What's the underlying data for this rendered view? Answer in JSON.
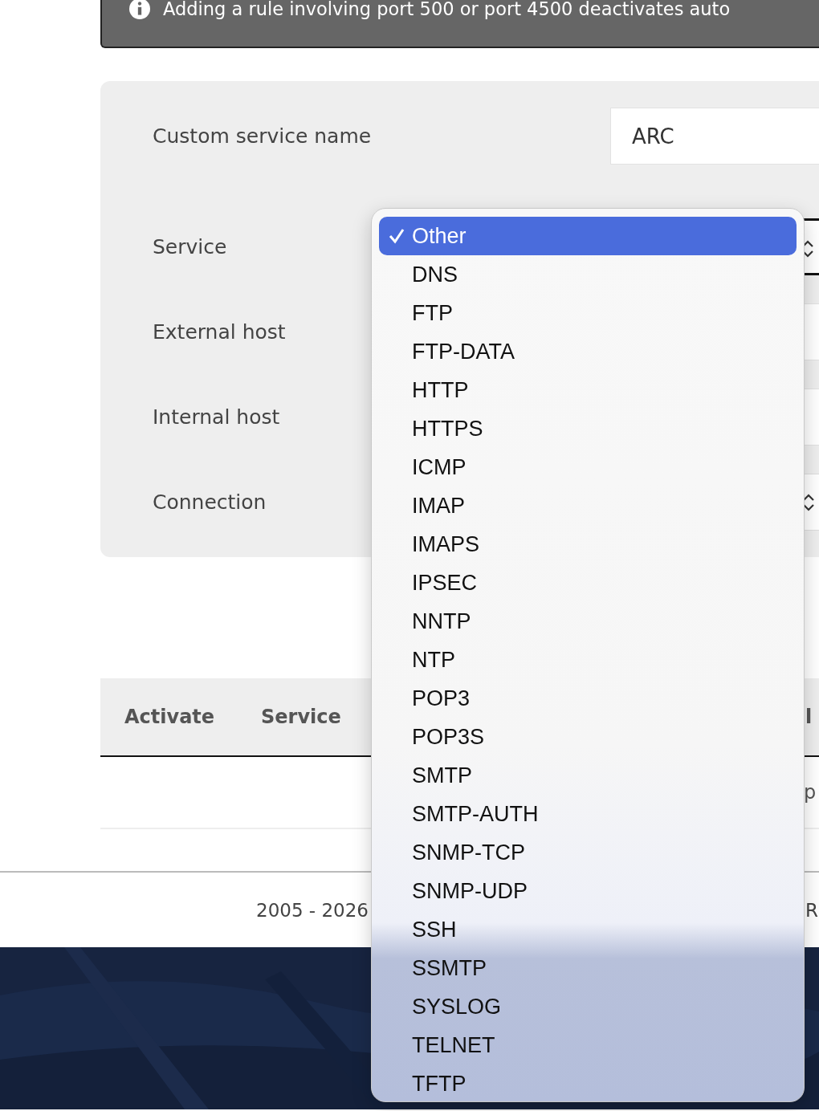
{
  "notice": {
    "text": "Adding a rule involving port 500 or port 4500 deactivates auto"
  },
  "form": {
    "fields": [
      {
        "label": "Custom service name",
        "kind": "input",
        "value": "ARC"
      },
      {
        "label": "Service",
        "kind": "select"
      },
      {
        "label": "External host",
        "kind": "input"
      },
      {
        "label": "Internal host",
        "kind": "input"
      },
      {
        "label": "Connection",
        "kind": "select"
      }
    ]
  },
  "table": {
    "columns": [
      "Activate",
      "Service",
      "l"
    ],
    "rows": [
      {
        "column_3": "p"
      }
    ]
  },
  "footer": {
    "copyright": "2005 - 2026",
    "right_text": "R"
  },
  "service_dropdown": {
    "options": [
      {
        "label": "Other",
        "selected": true
      },
      {
        "label": "DNS",
        "selected": false
      },
      {
        "label": "FTP",
        "selected": false
      },
      {
        "label": "FTP-DATA",
        "selected": false
      },
      {
        "label": "HTTP",
        "selected": false
      },
      {
        "label": "HTTPS",
        "selected": false
      },
      {
        "label": "ICMP",
        "selected": false
      },
      {
        "label": "IMAP",
        "selected": false
      },
      {
        "label": "IMAPS",
        "selected": false
      },
      {
        "label": "IPSEC",
        "selected": false
      },
      {
        "label": "NNTP",
        "selected": false
      },
      {
        "label": "NTP",
        "selected": false
      },
      {
        "label": "POP3",
        "selected": false
      },
      {
        "label": "POP3S",
        "selected": false
      },
      {
        "label": "SMTP",
        "selected": false
      },
      {
        "label": "SMTP-AUTH",
        "selected": false
      },
      {
        "label": "SNMP-TCP",
        "selected": false
      },
      {
        "label": "SNMP-UDP",
        "selected": false
      },
      {
        "label": "SSH",
        "selected": false
      },
      {
        "label": "SSMTP",
        "selected": false
      },
      {
        "label": "SYSLOG",
        "selected": false
      },
      {
        "label": "TELNET",
        "selected": false
      },
      {
        "label": "TFTP",
        "selected": false
      }
    ]
  }
}
